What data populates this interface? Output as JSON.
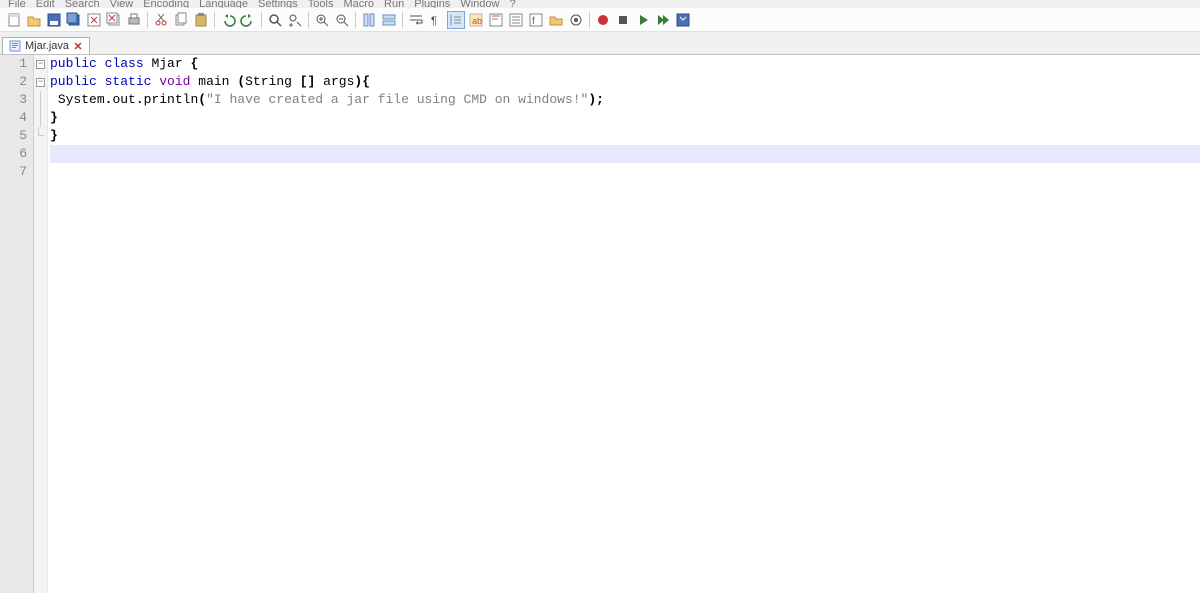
{
  "menu": {
    "items": [
      "File",
      "Edit",
      "Search",
      "View",
      "Encoding",
      "Language",
      "Settings",
      "Tools",
      "Macro",
      "Run",
      "Plugins",
      "Window",
      "?"
    ]
  },
  "toolbar": {
    "items": [
      {
        "name": "new-file-icon",
        "type": "new"
      },
      {
        "name": "open-file-icon",
        "type": "open"
      },
      {
        "name": "save-icon",
        "type": "save"
      },
      {
        "name": "save-all-icon",
        "type": "saveall"
      },
      {
        "name": "close-icon",
        "type": "close"
      },
      {
        "name": "close-all-icon",
        "type": "closeall"
      },
      {
        "name": "print-icon",
        "type": "print"
      },
      {
        "sep": true
      },
      {
        "name": "cut-icon",
        "type": "cut"
      },
      {
        "name": "copy-icon",
        "type": "copy"
      },
      {
        "name": "paste-icon",
        "type": "paste"
      },
      {
        "sep": true
      },
      {
        "name": "undo-icon",
        "type": "undo"
      },
      {
        "name": "redo-icon",
        "type": "redo"
      },
      {
        "sep": true
      },
      {
        "name": "find-icon",
        "type": "find"
      },
      {
        "name": "replace-icon",
        "type": "replace"
      },
      {
        "sep": true
      },
      {
        "name": "zoom-in-icon",
        "type": "zoomin"
      },
      {
        "name": "zoom-out-icon",
        "type": "zoomout"
      },
      {
        "sep": true
      },
      {
        "name": "sync-v-icon",
        "type": "syncv"
      },
      {
        "name": "sync-h-icon",
        "type": "synch"
      },
      {
        "sep": true
      },
      {
        "name": "wordwrap-icon",
        "type": "wrap"
      },
      {
        "name": "all-chars-icon",
        "type": "allchars"
      },
      {
        "name": "indent-guide-icon",
        "type": "indent",
        "active": true
      },
      {
        "name": "lang-icon",
        "type": "lang"
      },
      {
        "name": "doc-map-icon",
        "type": "docmap"
      },
      {
        "name": "doc-list-icon",
        "type": "doclist"
      },
      {
        "name": "func-list-icon",
        "type": "funclist"
      },
      {
        "name": "folder-icon",
        "type": "folder"
      },
      {
        "name": "monitor-icon",
        "type": "monitor"
      },
      {
        "sep": true
      },
      {
        "name": "record-icon",
        "type": "record"
      },
      {
        "name": "stop-icon",
        "type": "stop"
      },
      {
        "name": "play-icon",
        "type": "play"
      },
      {
        "name": "play-multi-icon",
        "type": "playmulti"
      },
      {
        "name": "save-macro-icon",
        "type": "savemacro"
      }
    ]
  },
  "tabs": [
    {
      "label": "Mjar.java"
    }
  ],
  "code": {
    "lines": [
      {
        "n": 1,
        "fold": "open",
        "tokens": [
          {
            "t": "kw",
            "v": "public"
          },
          {
            "t": "sp",
            "v": " "
          },
          {
            "t": "kw",
            "v": "class"
          },
          {
            "t": "sp",
            "v": " "
          },
          {
            "t": "cls",
            "v": "Mjar"
          },
          {
            "t": "sp",
            "v": " "
          },
          {
            "t": "punct",
            "v": "{"
          }
        ]
      },
      {
        "n": 2,
        "fold": "open",
        "tokens": [
          {
            "t": "kw",
            "v": "public"
          },
          {
            "t": "sp",
            "v": " "
          },
          {
            "t": "kw",
            "v": "static"
          },
          {
            "t": "sp",
            "v": " "
          },
          {
            "t": "type",
            "v": "void"
          },
          {
            "t": "sp",
            "v": " "
          },
          {
            "t": "ident",
            "v": "main"
          },
          {
            "t": "sp",
            "v": " "
          },
          {
            "t": "punct",
            "v": "("
          },
          {
            "t": "ident",
            "v": "String"
          },
          {
            "t": "sp",
            "v": " "
          },
          {
            "t": "punct",
            "v": "[]"
          },
          {
            "t": "sp",
            "v": " "
          },
          {
            "t": "ident",
            "v": "args"
          },
          {
            "t": "punct",
            "v": ")"
          },
          {
            "t": "punct",
            "v": "{"
          }
        ]
      },
      {
        "n": 3,
        "fold": "bar",
        "tokens": [
          {
            "t": "sp",
            "v": " "
          },
          {
            "t": "ident",
            "v": "System"
          },
          {
            "t": "punct",
            "v": "."
          },
          {
            "t": "ident",
            "v": "out"
          },
          {
            "t": "punct",
            "v": "."
          },
          {
            "t": "ident",
            "v": "println"
          },
          {
            "t": "punct",
            "v": "("
          },
          {
            "t": "str",
            "v": "\"I have created a jar file using CMD on windows!\""
          },
          {
            "t": "punct",
            "v": ")"
          },
          {
            "t": "punct",
            "v": ";"
          }
        ]
      },
      {
        "n": 4,
        "fold": "bar",
        "tokens": [
          {
            "t": "punct",
            "v": "}"
          }
        ]
      },
      {
        "n": 5,
        "fold": "end",
        "tokens": [
          {
            "t": "punct",
            "v": "}"
          }
        ]
      },
      {
        "n": 6,
        "fold": "",
        "current": true,
        "tokens": []
      },
      {
        "n": 7,
        "fold": "",
        "tokens": []
      }
    ]
  }
}
